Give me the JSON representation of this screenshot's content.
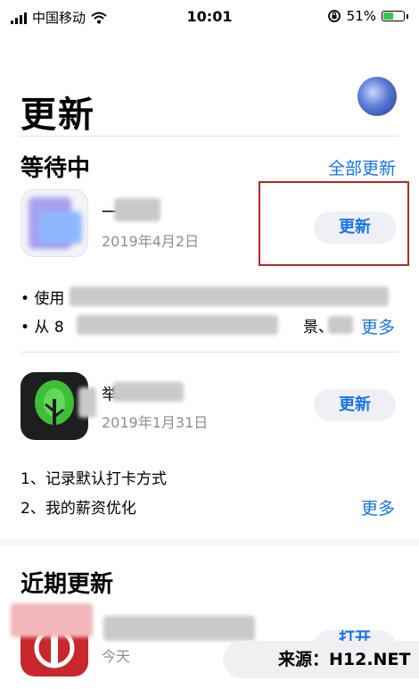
{
  "status_bar": {
    "carrier": "中国移动",
    "time": "10:01",
    "battery": "51%",
    "battery_level": 0.51
  },
  "page": {
    "title": "更新"
  },
  "pending": {
    "title": "等待中",
    "update_all": "全部更新",
    "apps": [
      {
        "name": "一",
        "date": "2019年4月2日",
        "button": "更新",
        "notes": [
          "• 使用",
          "• 从 8",
          "景、"
        ],
        "more": "更多"
      },
      {
        "name": "举",
        "date": "2019年1月31日",
        "button": "更新",
        "notes": [
          "1、记录默认打卡方式",
          "2、我的薪资优化"
        ],
        "more": "更多"
      }
    ]
  },
  "recent": {
    "title": "近期更新",
    "apps": [
      {
        "date": "今天",
        "button": "打开"
      }
    ]
  },
  "watermark": {
    "text": "来源：H12.NET"
  }
}
